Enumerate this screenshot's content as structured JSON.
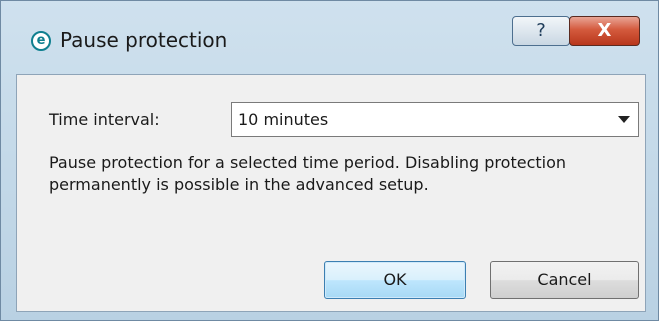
{
  "window": {
    "title": "Pause protection",
    "app_icon_letter": "e",
    "help_symbol": "?",
    "close_symbol": "X"
  },
  "form": {
    "time_interval_label": "Time interval:",
    "time_interval_selected": "10 minutes",
    "description": "Pause protection for a selected time period. Disabling protection permanently is possible in the advanced setup."
  },
  "buttons": {
    "ok_label": "OK",
    "cancel_label": "Cancel"
  },
  "colors": {
    "accent": "#3c7fb1",
    "close_red": "#c8452a",
    "app_icon": "#0f7f8f"
  },
  "icons": {
    "app": "eset-logo-icon",
    "help": "help-icon",
    "close": "close-icon",
    "dropdown": "chevron-down-icon"
  }
}
